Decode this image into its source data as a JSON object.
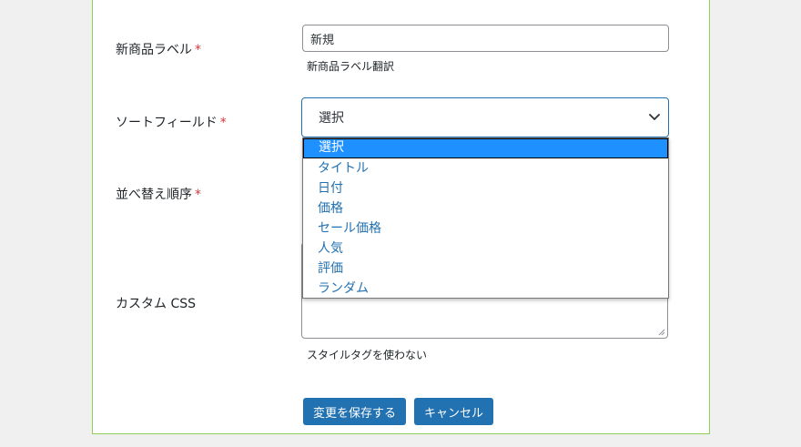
{
  "form": {
    "new_label": {
      "label": "新商品ラベル",
      "required_mark": "*",
      "value": "新規",
      "help": "新商品ラベル翻訳"
    },
    "sort_field": {
      "label": "ソートフィールド",
      "required_mark": "*",
      "selected": "選択",
      "options": [
        "選択",
        "タイトル",
        "日付",
        "価格",
        "セール価格",
        "人気",
        "評価",
        "ランダム"
      ]
    },
    "sort_order": {
      "label": "並べ替え順序",
      "required_mark": "*"
    },
    "custom_css": {
      "label": "カスタム CSS",
      "help": "スタイルタグを使わない"
    }
  },
  "buttons": {
    "save": "変更を保存する",
    "cancel": "キャンセル"
  },
  "colors": {
    "accent": "#2271b1",
    "required": "#d63638",
    "highlight": "#1e90ff",
    "panel_border": "#8fce5a"
  },
  "icons": {
    "select_arrow": "chevron-down-icon",
    "resize": "resize-handle-icon"
  }
}
